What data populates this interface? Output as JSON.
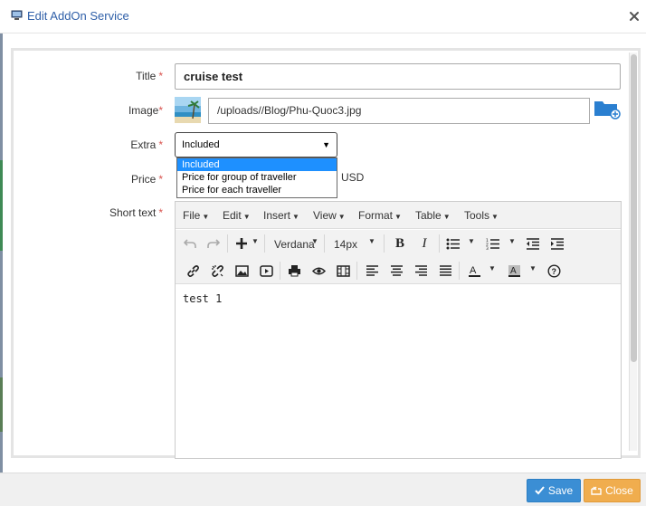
{
  "dialog": {
    "title": "Edit AddOn Service",
    "title_icon": "monitor-icon",
    "close_icon": "close-icon"
  },
  "form": {
    "title_label": "Title",
    "title_value": "cruise test",
    "image_label": "Image",
    "image_value": "/uploads//Blog/Phu-Quoc3.jpg",
    "image_browse_icon": "folder-add-icon",
    "extra_label": "Extra",
    "extra_selected": "Included",
    "extra_options": [
      "Included",
      "Price for group of traveller",
      "Price for each traveller"
    ],
    "price_label": "Price",
    "price_currency": "USD",
    "short_text_label": "Short text",
    "required_mark": "*"
  },
  "editor": {
    "menus": [
      "File",
      "Edit",
      "Insert",
      "View",
      "Format",
      "Table",
      "Tools"
    ],
    "font_name": "Verdana",
    "font_size": "14px",
    "content": "test 1",
    "toolbar_icons": [
      "undo-icon",
      "redo-icon",
      "insert-plus-icon",
      "bold-icon",
      "italic-icon",
      "bullet-list-icon",
      "numbered-list-icon",
      "outdent-icon",
      "indent-icon",
      "link-icon",
      "unlink-icon",
      "image-icon",
      "media-icon",
      "print-icon",
      "preview-icon",
      "template-icon",
      "align-left-icon",
      "align-center-icon",
      "align-right-icon",
      "align-justify-icon",
      "text-color-icon",
      "background-color-icon",
      "help-icon"
    ]
  },
  "footer": {
    "save_label": "Save",
    "close_label": "Close"
  },
  "colors": {
    "accent": "#3b8ed4",
    "warning": "#f0ad4e",
    "required": "#d9534f",
    "title_blue": "#2f5fa8",
    "selected_option": "#1e90ff"
  }
}
